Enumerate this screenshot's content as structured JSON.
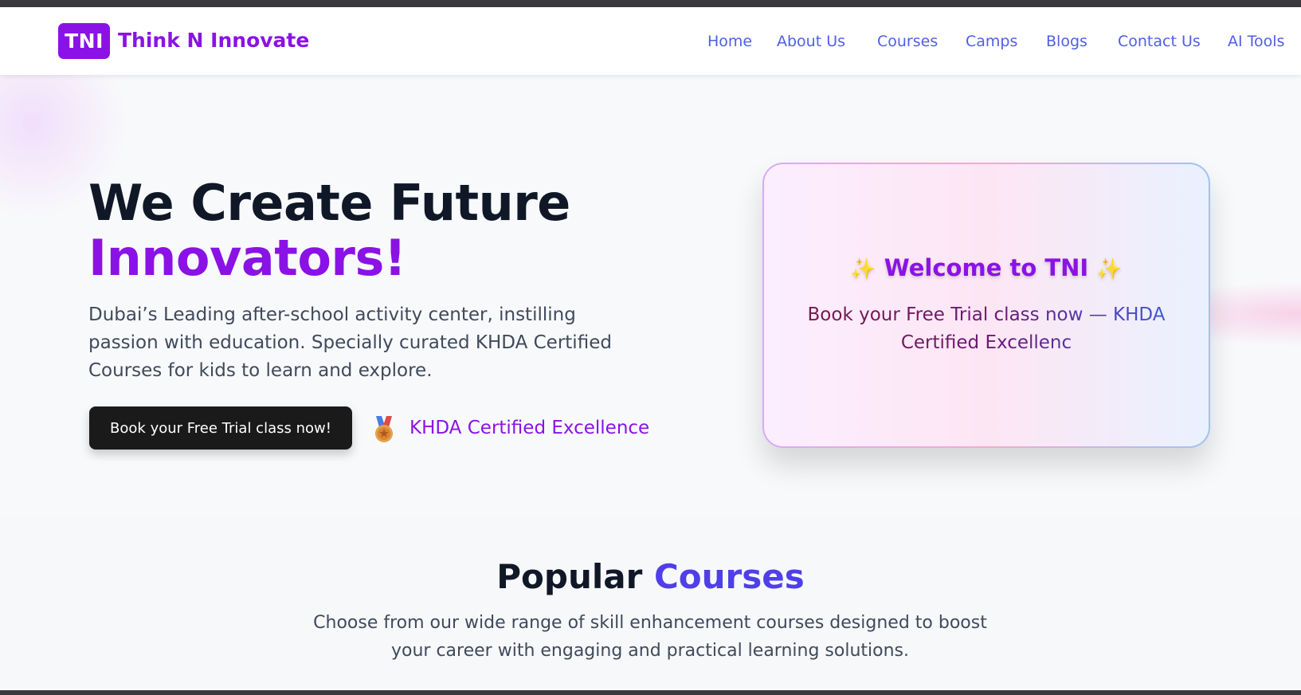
{
  "brand": {
    "logo_mark": "TNI",
    "name": "Think N Innovate",
    "color": "#8b12e6"
  },
  "nav": {
    "items": [
      "Home",
      "About Us",
      "Courses",
      "Camps",
      "Blogs",
      "Contact Us",
      "AI Tools"
    ],
    "link_color": "#4f5fe3"
  },
  "hero": {
    "title_line1": "We Create Future",
    "title_line2": "Innovators!",
    "description": "Dubai’s Leading after-school activity center, instilling passion with education. Specially curated KHDA Certified Courses for kids to learn and explore.",
    "cta_label": "Book your Free Trial class now!",
    "badge_icon": "medal-icon",
    "badge_text": "KHDA Certified Excellence"
  },
  "welcome_card": {
    "sparkle_icon": "sparkles-icon",
    "sparkle_glyph": "✨",
    "title": "Welcome to TNI",
    "subtitle": "Book your Free Trial class now — KHDA Certified Excellenc"
  },
  "courses": {
    "title_plain": "Popular",
    "title_accent": "Courses",
    "description": "Choose from our wide range of skill enhancement courses designed to boost your career with engaging and practical learning solutions."
  }
}
